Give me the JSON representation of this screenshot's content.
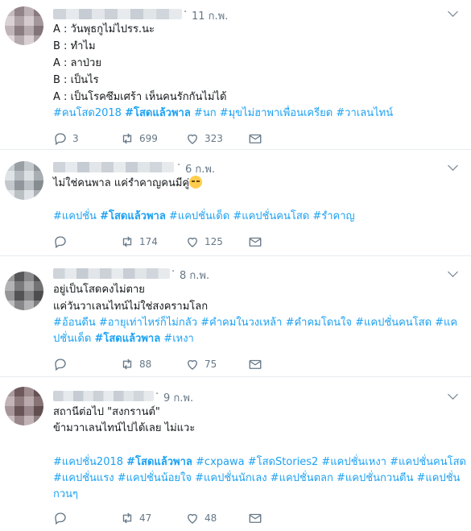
{
  "tweets": [
    {
      "date": "11 ก.พ.",
      "lines": [
        "A : วันพุธกูไม่ไปรร.นะ",
        "B : ทำไม",
        "A : ลาป่วย",
        "B : เป็นไร",
        "A : เป็นโรคซึมเศร้า เห็นคนรักกันไม่ได้"
      ],
      "hashtags": {
        "a": "#คนโสด2018 ",
        "b": "#โสดแล้วพาล",
        "c": " #นก #มุขไม่ฮาพาเพื่อนเครียด #วาเลนไทน์"
      },
      "reply_count": "3",
      "retweet_count": "699",
      "like_count": "323"
    },
    {
      "date": "6 ก.พ.",
      "text": "ไม่ใช่คนพาล แค่รำคาญคนมีคู่",
      "emoji_name": "unamused-face-emoji",
      "hashtags": {
        "a": "#แคปชั่น ",
        "b": "#โสดแล้วพาล",
        "c": " #แคปชั่นเด็ด #แคปชั่นคนโสด #รำคาญ"
      },
      "reply_count": "",
      "retweet_count": "174",
      "like_count": "125"
    },
    {
      "date": "8 ก.พ.",
      "lines": [
        "อยู่เป็นโสดคงไม่ตาย",
        "แค่วันวาเลนไทน์ไม่ใช่สงครามโลก"
      ],
      "hashtags_line1": "#อ้อนดีน #อายุเท่าไหร่ก็ไม่กลัว #คำคมในวงเหล้า #คำคมโดนใจ #แคปชั่นคนโสด #แค",
      "hashtags_line2": {
        "a": "ปชั่นเด็ด ",
        "b": "#โสดแล้วพาล",
        "c": " #เหงา"
      },
      "reply_count": "",
      "retweet_count": "88",
      "like_count": "75"
    },
    {
      "date": "9 ก.พ.",
      "lines": [
        "สถานีต่อไป \"สงกรานต์\"",
        "ข้ามวาเลนไทน์ไปได้เลย ไม่แวะ"
      ],
      "hashtags_line1": {
        "a": "#แคปชั่น2018 ",
        "b": "#โสดแล้วพาล",
        "c": " #cxpawa #โสดStories2 #แคปชั่นเหงา #แคปชั่นคนโสด"
      },
      "hashtags_line2": "#แคปชั่นแรง #แคปชั่นน้อยใจ #แคปชั่นนักเลง #แคปชั่นตลก #แคปชั่นกวนตีน #แคปชั่น",
      "hashtags_line3": "กวนๆ",
      "reply_count": "",
      "retweet_count": "47",
      "like_count": "48"
    }
  ],
  "colors": {
    "hashtag": "#1da1f2",
    "meta": "#657786",
    "text": "#14171a",
    "divider": "#e6ecf0"
  }
}
